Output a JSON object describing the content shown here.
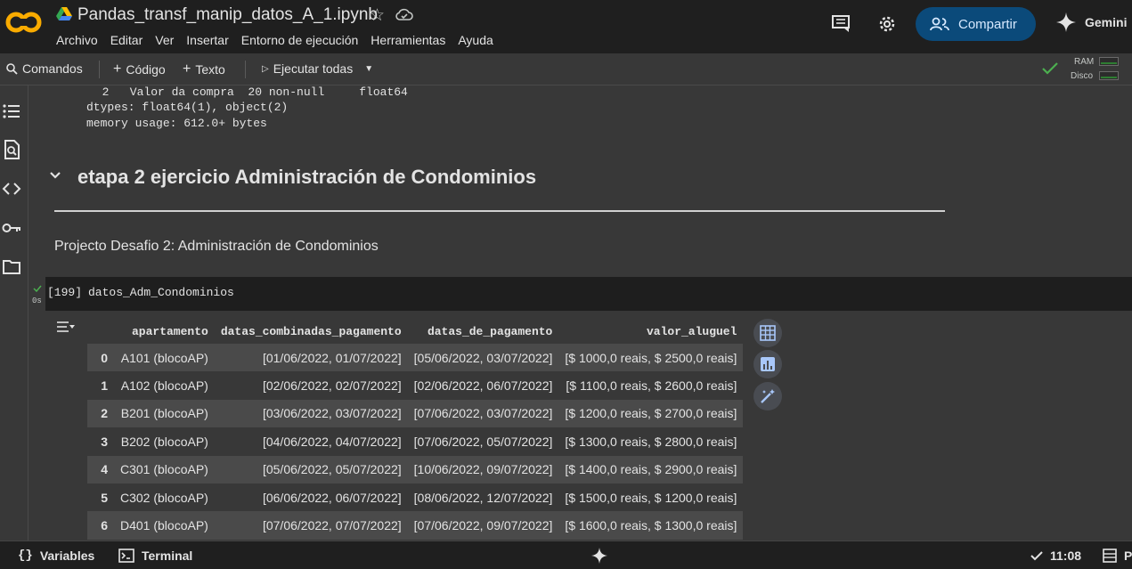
{
  "header": {
    "notebook_title": "Pandas_transf_manip_datos_A_1.ipynb",
    "menu": [
      "Archivo",
      "Editar",
      "Ver",
      "Insertar",
      "Entorno de ejecución",
      "Herramientas",
      "Ayuda"
    ],
    "share_label": "Compartir",
    "gemini_label": "Gemini"
  },
  "toolbar": {
    "commands_label": "Comandos",
    "add_code_label": "Código",
    "add_text_label": "Texto",
    "run_all_label": "Ejecutar todas",
    "ram_label": "RAM",
    "disk_label": "Disco"
  },
  "output_prev": {
    "line1": "  2   Valor da compra  20 non-null     float64",
    "line2": "dtypes: float64(1), object(2)",
    "line3": "memory usage: 612.0+ bytes"
  },
  "section": {
    "title": "etapa 2 ejercicio Administración de Condominios",
    "subtitle": "Projecto Desafio 2: Administración de Condominios"
  },
  "code_cell": {
    "exec_time": "0s",
    "exec_count": "[199]",
    "code": "datos_Adm_Condominios"
  },
  "dataframe": {
    "columns": [
      "apartamento",
      "datas_combinadas_pagamento",
      "datas_de_pagamento",
      "valor_aluguel"
    ],
    "rows": [
      {
        "idx": "0",
        "cells": [
          "A101 (blocoAP)",
          "[01/06/2022, 01/07/2022]",
          "[05/06/2022, 03/07/2022]",
          "[$ 1000,0 reais, $ 2500,0 reais]"
        ]
      },
      {
        "idx": "1",
        "cells": [
          "A102 (blocoAP)",
          "[02/06/2022, 02/07/2022]",
          "[02/06/2022, 06/07/2022]",
          "[$ 1100,0 reais, $ 2600,0 reais]"
        ]
      },
      {
        "idx": "2",
        "cells": [
          "B201 (blocoAP)",
          "[03/06/2022, 03/07/2022]",
          "[07/06/2022, 03/07/2022]",
          "[$ 1200,0 reais, $ 2700,0 reais]"
        ]
      },
      {
        "idx": "3",
        "cells": [
          "B202 (blocoAP)",
          "[04/06/2022, 04/07/2022]",
          "[07/06/2022, 05/07/2022]",
          "[$ 1300,0 reais, $ 2800,0 reais]"
        ]
      },
      {
        "idx": "4",
        "cells": [
          "C301 (blocoAP)",
          "[05/06/2022, 05/07/2022]",
          "[10/06/2022, 09/07/2022]",
          "[$ 1400,0 reais, $ 2900,0 reais]"
        ]
      },
      {
        "idx": "5",
        "cells": [
          "C302 (blocoAP)",
          "[06/06/2022, 06/07/2022]",
          "[08/06/2022, 12/07/2022]",
          "[$ 1500,0 reais, $ 1200,0 reais]"
        ]
      },
      {
        "idx": "6",
        "cells": [
          "D401 (blocoAP)",
          "[07/06/2022, 07/07/2022]",
          "[07/06/2022, 09/07/2022]",
          "[$ 1600,0 reais, $ 1300,0 reais]"
        ]
      }
    ]
  },
  "statusbar": {
    "variables_label": "Variables",
    "terminal_label": "Terminal",
    "time": "11:08",
    "right_label": "P"
  },
  "colors": {
    "accent_blue": "#0b4a7a",
    "success_green": "#4caf50",
    "logo_orange": "#f9ab00"
  }
}
